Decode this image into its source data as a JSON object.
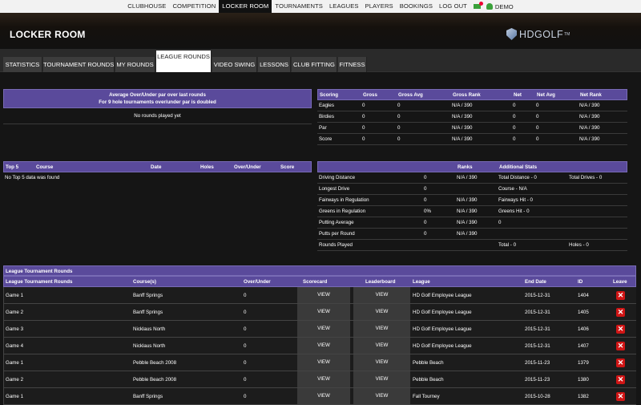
{
  "topnav": {
    "items": [
      "CLUBHOUSE",
      "COMPETITION",
      "LOCKER ROOM",
      "TOURNAMENTS",
      "LEAGUES",
      "PLAYERS",
      "BOOKINGS",
      "LOG OUT"
    ],
    "active": "LOCKER ROOM",
    "user": "DEMO"
  },
  "header": {
    "title": "LOCKER ROOM",
    "logo_text": "HDGOLF",
    "logo_tm": "TM"
  },
  "tabs": [
    "STATISTICS",
    "TOURNAMENT ROUNDS",
    "MY ROUNDS",
    "LEAGUE ROUNDS",
    "VIDEO SWING",
    "LESSONS",
    "CLUB FITTING",
    "FITNESS"
  ],
  "active_tab": "LEAGUE ROUNDS",
  "over_under": {
    "title_line1": "Average Over/Under par over last rounds",
    "title_line2": "For 9 hole tournaments over/under par is doubled",
    "message": "No rounds played yet"
  },
  "scoring": {
    "headers": [
      "Scoring",
      "Gross",
      "Gross Avg",
      "Gross Rank",
      "Net",
      "Net Avg",
      "Net Rank"
    ],
    "rows": [
      [
        "Eagles",
        "0",
        "0",
        "N/A / 390",
        "0",
        "0",
        "N/A / 390"
      ],
      [
        "Birdies",
        "0",
        "0",
        "N/A / 390",
        "0",
        "0",
        "N/A / 390"
      ],
      [
        "Par",
        "0",
        "0",
        "N/A / 390",
        "0",
        "0",
        "N/A / 390"
      ],
      [
        "Score",
        "0",
        "0",
        "N/A / 390",
        "0",
        "0",
        "N/A / 390"
      ]
    ]
  },
  "top5": {
    "headers": [
      "Top 5",
      "Course",
      "Date",
      "Holes",
      "Over/Under",
      "Score"
    ],
    "message": "No Top 5 data was found"
  },
  "stats": {
    "headers": [
      "",
      "",
      "Ranks",
      "Additional Stats",
      ""
    ],
    "rows": [
      [
        "Driving Distance",
        "0",
        "N/A / 390",
        "Total Distance - 0",
        "Total Drives - 0"
      ],
      [
        "Longest Drive",
        "0",
        "",
        "Course - N/A",
        ""
      ],
      [
        "Fairways in Regulation",
        "0",
        "N/A / 390",
        "Fairways Hit - 0",
        ""
      ],
      [
        "Greens in Regulation",
        "0%",
        "N/A / 390",
        "Greens Hit - 0",
        ""
      ],
      [
        "Putting Average",
        "0",
        "N/A / 390",
        "0",
        ""
      ],
      [
        "Putts per Round",
        "0",
        "N/A / 390",
        "",
        ""
      ],
      [
        "Rounds Played",
        "",
        "",
        "Total - 0",
        "Holes - 0"
      ]
    ]
  },
  "league": {
    "title": "League Tournament Rounds",
    "headers": [
      "League Tournament Rounds",
      "Course(s)",
      "Over/Under",
      "Scorecard",
      "Leaderboard",
      "League",
      "End Date",
      "ID",
      "Leave"
    ],
    "view_label": "VIEW",
    "delete_glyph": "✕",
    "rows": [
      [
        "Game 1",
        "Banff Springs",
        "0",
        "HD Golf Employee League",
        "2015-12-31",
        "1404"
      ],
      [
        "Game 2",
        "Banff Springs",
        "0",
        "HD Golf Employee League",
        "2015-12-31",
        "1405"
      ],
      [
        "Game 3",
        "Nicklaus North",
        "0",
        "HD Golf Employee League",
        "2015-12-31",
        "1406"
      ],
      [
        "Game 4",
        "Nicklaus North",
        "0",
        "HD Golf Employee League",
        "2015-12-31",
        "1407"
      ],
      [
        "Game 1",
        "Pebble Beach 2008",
        "0",
        "Pebble Beach",
        "2015-11-23",
        "1379"
      ],
      [
        "Game 2",
        "Pebble Beach 2008",
        "0",
        "Pebble Beach",
        "2015-11-23",
        "1380"
      ],
      [
        "Game 1",
        "Banff Springs",
        "0",
        "Fall Tourney",
        "2015-10-28",
        "1382"
      ]
    ]
  },
  "colors": {
    "header_purple": "#5a4a9b",
    "delete_red": "#d01515",
    "active_nav": "#111111"
  }
}
